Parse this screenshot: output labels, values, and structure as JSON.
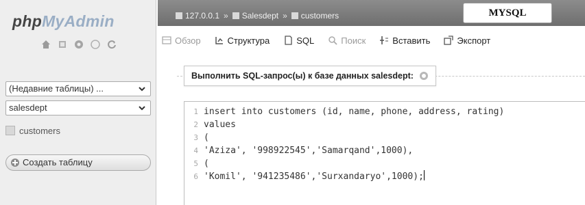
{
  "brand": {
    "php": "php",
    "myadmin": "MyAdmin"
  },
  "nav": {
    "icons": [
      "home-icon",
      "database-icon",
      "gear-icon",
      "docs-icon",
      "refresh-icon"
    ],
    "recent_tables": "(Недавние таблицы) ...",
    "database": "salesdept",
    "tables": [
      "customers"
    ],
    "create_table": "Создать таблицу"
  },
  "breadcrumb": {
    "server": "127.0.0.1",
    "database": "Salesdept",
    "table": "customers"
  },
  "overlay_label": "MYSQL",
  "tabs": [
    {
      "label": "Обзор",
      "icon": "browse-icon",
      "enabled": false
    },
    {
      "label": "Структура",
      "icon": "structure-icon",
      "enabled": true
    },
    {
      "label": "SQL",
      "icon": "sql-icon",
      "enabled": true
    },
    {
      "label": "Поиск",
      "icon": "search-icon",
      "enabled": false
    },
    {
      "label": "Вставить",
      "icon": "insert-icon",
      "enabled": true
    },
    {
      "label": "Экспорт",
      "icon": "export-icon",
      "enabled": true
    }
  ],
  "query": {
    "legend": "Выполнить SQL-запрос(ы) к базе данных salesdept:",
    "lines": [
      {
        "num": "1",
        "text": "insert into customers (id, name, phone, address, rating)"
      },
      {
        "num": "2",
        "text": "values"
      },
      {
        "num": "3",
        "text": "("
      },
      {
        "num": "4",
        "text": "'Aziza', '998922545','Samarqand',1000),"
      },
      {
        "num": "5",
        "text": "("
      },
      {
        "num": "6",
        "text": "'Komil', '941235486','Surxandaryo',1000);"
      }
    ]
  }
}
